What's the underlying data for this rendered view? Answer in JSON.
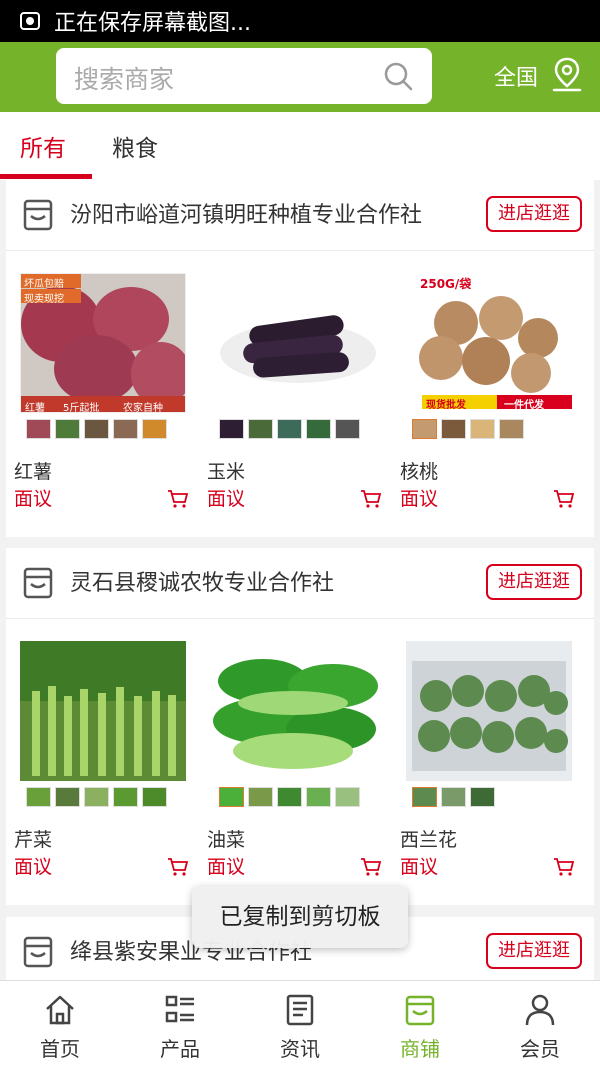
{
  "status_bar": {
    "text": "正在保存屏幕截图..."
  },
  "search": {
    "placeholder": "搜索商家"
  },
  "region": "全国",
  "tabs": [
    {
      "label": "所有"
    },
    {
      "label": "粮食"
    }
  ],
  "shops": [
    {
      "name": "汾阳市峪道河镇明旺种植专业合作社",
      "button": "进店逛逛",
      "products": [
        {
          "name": "红薯",
          "price": "面议",
          "overlay": [
            "坏瓜包赔",
            "现卖现挖",
            "红薯",
            "5斤起批",
            "农家自种"
          ]
        },
        {
          "name": "玉米",
          "price": "面议",
          "overlay": []
        },
        {
          "name": "核桃",
          "price": "面议",
          "overlay": [
            "250G/袋",
            "现货批发",
            "一件代发"
          ]
        }
      ]
    },
    {
      "name": "灵石县稷诚农牧专业合作社",
      "button": "进店逛逛",
      "products": [
        {
          "name": "芹菜",
          "price": "面议",
          "overlay": []
        },
        {
          "name": "油菜",
          "price": "面议",
          "overlay": []
        },
        {
          "name": "西兰花",
          "price": "面议",
          "overlay": []
        }
      ]
    },
    {
      "name": "绛县紫安果业专业合作社",
      "button": "进店逛逛",
      "products": []
    }
  ],
  "toast": "已复制到剪切板",
  "bottom_nav": [
    {
      "label": "首页",
      "icon": "home-icon"
    },
    {
      "label": "产品",
      "icon": "product-list-icon"
    },
    {
      "label": "资讯",
      "icon": "news-icon"
    },
    {
      "label": "商铺",
      "icon": "store-icon",
      "active": true
    },
    {
      "label": "会员",
      "icon": "member-icon"
    }
  ],
  "colors": {
    "brand_green": "#75b32a",
    "accent_red": "#d6001c"
  }
}
